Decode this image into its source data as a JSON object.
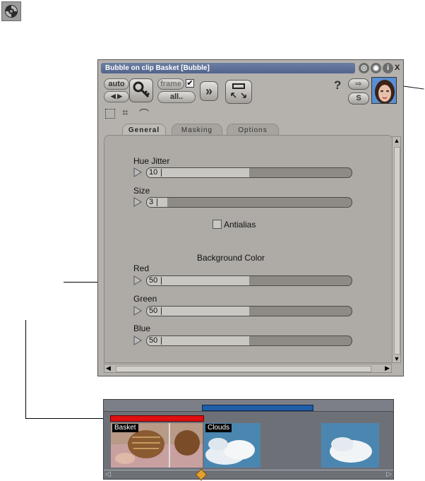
{
  "window": {
    "title": "Bubble on clip Basket [Bubble]",
    "controls": {
      "close": "X"
    }
  },
  "toolbar": {
    "auto_label": "auto",
    "frame_label": "frame",
    "all_label": "all..",
    "help_label": "?",
    "cs_label": "S"
  },
  "tabs": [
    {
      "label": "General",
      "active": true
    },
    {
      "label": "Masking",
      "active": false
    },
    {
      "label": "Options",
      "active": false
    }
  ],
  "params": {
    "hue_jitter": {
      "label": "Hue Jitter",
      "value": "10",
      "fraction": 0.5
    },
    "size": {
      "label": "Size",
      "value": "3",
      "fraction": 0.1
    },
    "antialias": {
      "label": "Antialias",
      "checked": false
    },
    "background_color_heading": "Background Color",
    "red": {
      "label": "Red",
      "value": "50",
      "fraction": 0.5
    },
    "green": {
      "label": "Green",
      "value": "50",
      "fraction": 0.5
    },
    "blue": {
      "label": "Blue",
      "value": "50",
      "fraction": 0.5
    }
  },
  "timeline": {
    "clips": [
      {
        "label": "Basket"
      },
      {
        "label": "Clouds"
      }
    ]
  },
  "colors": {
    "accent_red": "#e01010",
    "accent_blue": "#1f5ea8",
    "titlebar": "#5b6d94",
    "playhead": "#e0a030"
  }
}
